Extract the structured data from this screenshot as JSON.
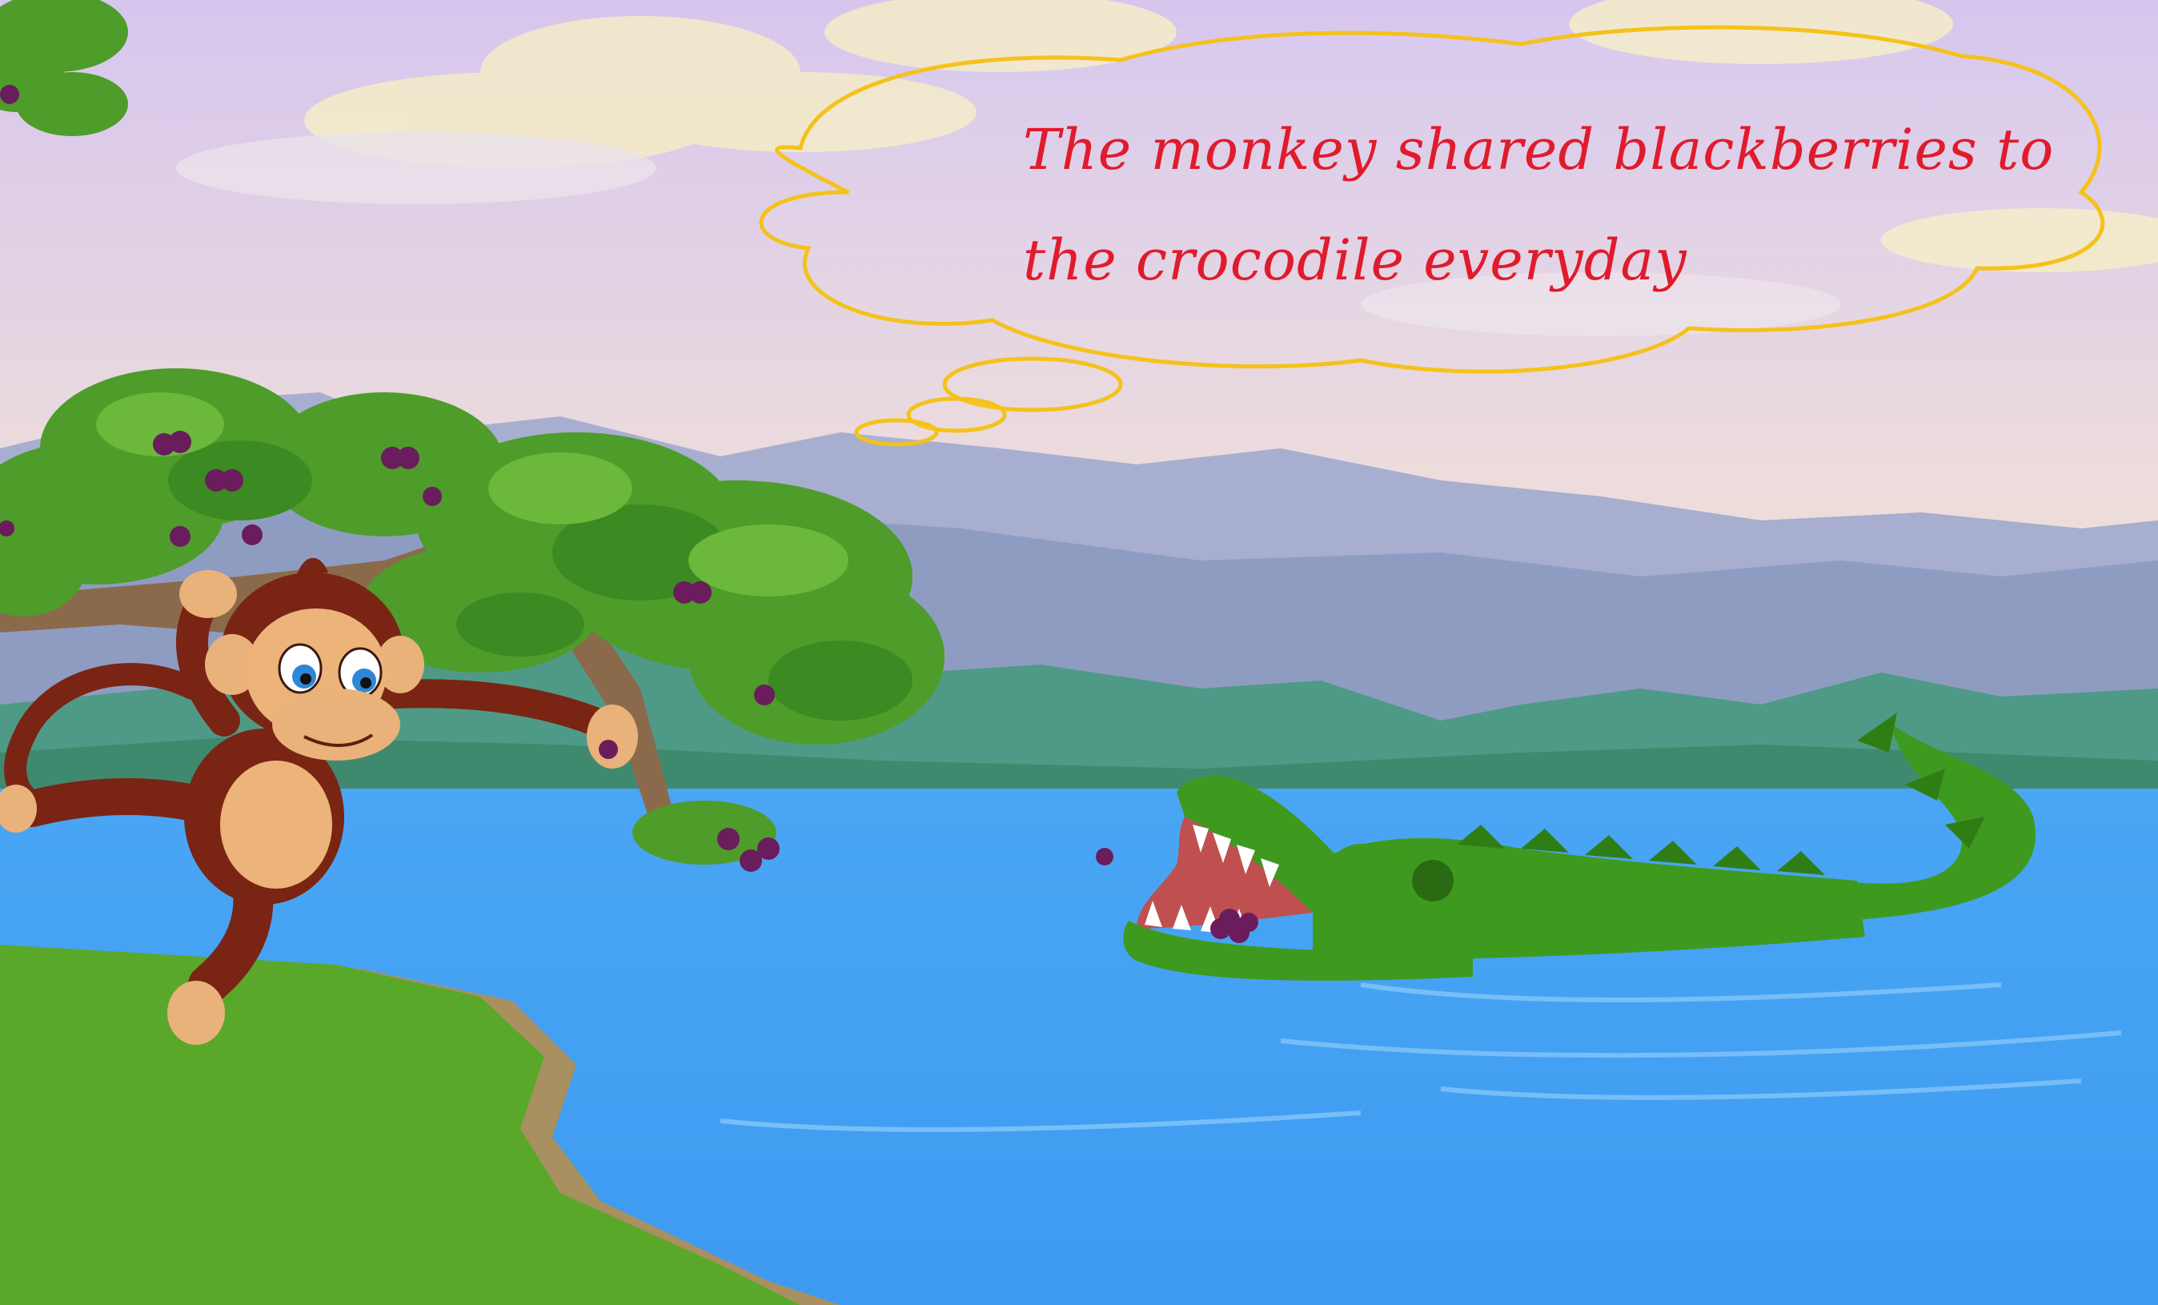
{
  "story": {
    "caption_line_1": "The monkey shared blackberries to",
    "caption_line_2": "the crocodile everyday"
  },
  "colors": {
    "sky_top": "#d9c9ec",
    "sky_bottom": "#f4e4cf",
    "water": "#45a3f4",
    "grass": "#5aa82a",
    "caption_text": "#e01b2c",
    "bubble_outline": "#f4c21a",
    "crocodile": "#3e9a1e",
    "monkey_fur": "#7a2414",
    "berry": "#6a1c5c"
  }
}
